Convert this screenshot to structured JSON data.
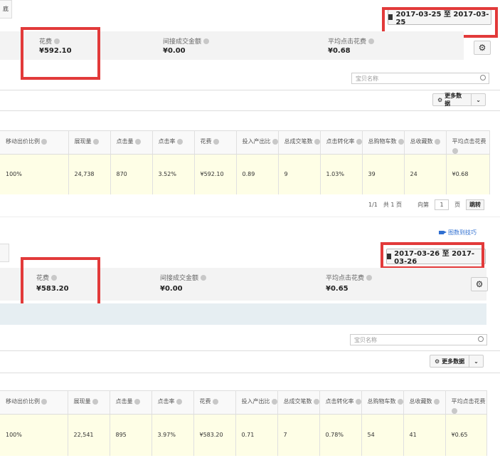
{
  "top": {
    "tab_stub_label": "底",
    "date_range": "2017-03-25 至 2017-03-25",
    "metrics": [
      {
        "label": "花费",
        "value": "¥592.10"
      },
      {
        "label": "间接成交金额",
        "value": "¥0.00"
      },
      {
        "label": "平均点击花费",
        "value": "¥0.68"
      }
    ],
    "search_placeholder": "宝贝名称",
    "more_data_label": "更多数据",
    "columns": [
      "移动出价比例",
      "展现量",
      "点击量",
      "点击率",
      "花费",
      "投入产出比",
      "总成交笔数",
      "点击转化率",
      "总购物车数",
      "总收藏数",
      "平均点击花费"
    ],
    "row": [
      "100%",
      "24,738",
      "870",
      "3.52%",
      "¥592.10",
      "0.89",
      "9",
      "1.03%",
      "39",
      "24",
      "¥0.68"
    ],
    "pager": {
      "page_status": "1/1",
      "total_pages": "共 1 页",
      "goto_prefix": "向第",
      "page_value": "1",
      "goto_suffix": "页",
      "jump_label": "跳转"
    }
  },
  "bottom": {
    "tip_link": "图数到技巧",
    "date_range": "2017-03-26 至 2017-03-26",
    "metrics": [
      {
        "label": "花费",
        "value": "¥583.20"
      },
      {
        "label": "间接成交金额",
        "value": "¥0.00"
      },
      {
        "label": "平均点击花费",
        "value": "¥0.65"
      }
    ],
    "search_placeholder": "宝贝名称",
    "more_data_label": "更多数据",
    "columns": [
      "移动出价比例",
      "展现量",
      "点击量",
      "点击率",
      "花费",
      "投入产出比",
      "总成交笔数",
      "点击转化率",
      "总购物车数",
      "总收藏数",
      "平均点击花费"
    ],
    "row": [
      "100%",
      "22,541",
      "895",
      "3.97%",
      "¥583.20",
      "0.71",
      "7",
      "0.78%",
      "54",
      "41",
      "¥0.65"
    ]
  },
  "colors": {
    "highlight": "#e23a3a",
    "row_bg": "#fefee6",
    "link": "#2f6fd1"
  }
}
